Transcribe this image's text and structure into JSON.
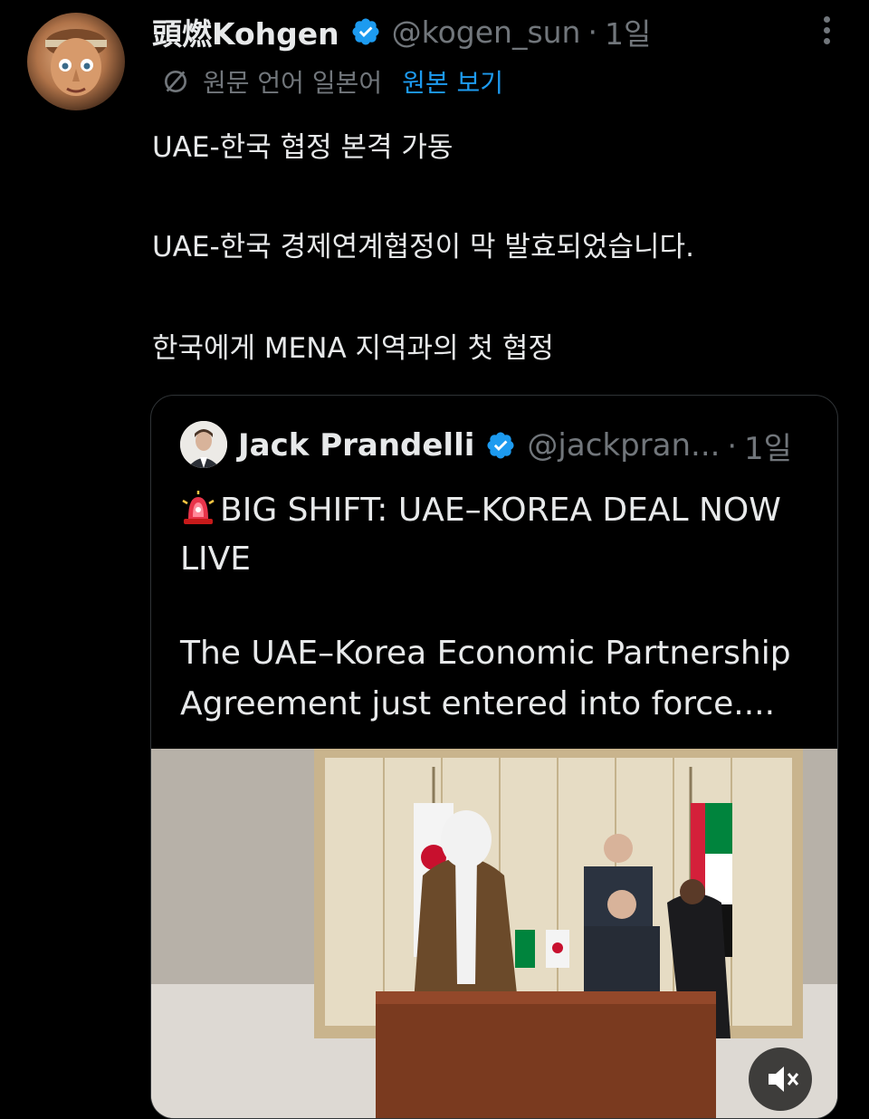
{
  "tweet": {
    "display_name": "頭燃Kohgen",
    "handle": "@kogen_sun",
    "separator": "·",
    "time": "1일",
    "translate": {
      "language_label": "원문 언어 일본어",
      "show_original": "원본 보기"
    },
    "lines": [
      "UAE-한국 협정 본격 가동",
      "UAE-한국 경제연계협정이 막 발효되었습니다.",
      "한국에게 MENA 지역과의 첫 협정"
    ]
  },
  "quote": {
    "display_name": "Jack Prandelli",
    "handle": "@jackpran...",
    "separator": "·",
    "time": "1일",
    "lines": [
      "BIG SHIFT: UAE–KOREA DEAL NOW",
      "LIVE",
      "The UAE–Korea Economic Partnership",
      "Agreement just entered into force...."
    ]
  },
  "colors": {
    "background": "#000000",
    "text": "#e7e9ea",
    "secondary": "#71767b",
    "link": "#1d9bf0",
    "verified": "#1d9bf0",
    "border": "#2f3336"
  },
  "icons": [
    "verified-badge-icon",
    "more-options-icon",
    "translate-icon",
    "siren-emoji-icon",
    "mute-icon"
  ]
}
